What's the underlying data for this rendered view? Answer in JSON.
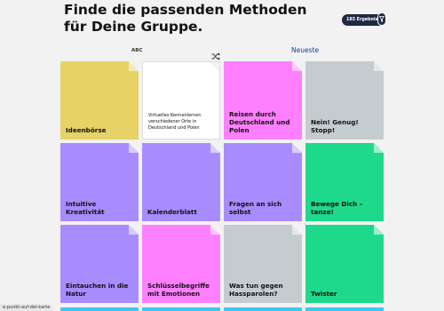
{
  "header": {
    "title_line1": "Finde die passenden Methoden",
    "title_line2": "für Deine Gruppe.",
    "results_label": "183 Ergebnisse"
  },
  "sort": {
    "abc_label": "ABC",
    "shuffle_icon": "shuffle-icon",
    "newest_label": "Neueste"
  },
  "cards": [
    {
      "label": "Ideenbörse",
      "color": "#e6d266"
    },
    {
      "label": "Virtuelles Kennenlernen verschiedener Orte in Deutschland und Polen",
      "color": "#ffffff"
    },
    {
      "label": "Reisen durch Deutschland und Polen",
      "color": "#ff80ff"
    },
    {
      "label": "Nein! Genug! Stopp!",
      "color": "#c5ccd0"
    },
    {
      "label": "Intuitive Kreativität",
      "color": "#a88cff"
    },
    {
      "label": "Kalenderblatt",
      "color": "#a88cff"
    },
    {
      "label": "Fragen an sich selbst",
      "color": "#a88cff"
    },
    {
      "label": "Bewege Dich – tanze!",
      "color": "#1ed98c"
    },
    {
      "label": "Eintauchen in die Natur",
      "color": "#a88cff"
    },
    {
      "label": "Schlüsselbegriffe mit Emotionen",
      "color": "#ff80ff"
    },
    {
      "label": "Was tun gegen Hassparolen?",
      "color": "#c5ccd0"
    },
    {
      "label": "Twister",
      "color": "#1ed98c"
    }
  ],
  "status": {
    "url": "e-punkt-auf-der-karte"
  }
}
